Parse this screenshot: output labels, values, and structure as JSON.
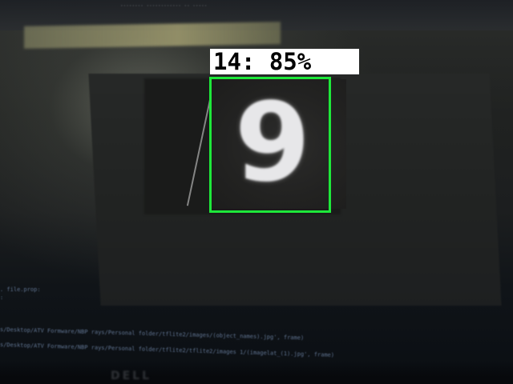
{
  "detection": {
    "class_id": "14",
    "confidence": "85%",
    "label": "14: 85%",
    "box_color": "#1ee83a"
  },
  "scene": {
    "digit_shown": "9",
    "brand": "DELL",
    "terminal_lines": [
      ". file.prop:",
      ":",
      "s/Desktop/ATV Formware/NBP rays/Personal folder/tflite2/images/(object_names).jpg', frame)",
      "s/Desktop/ATV Formware/NBP rays/Personal folder/tflite2/tflite2/images 1/(imagelat_(1).jpg', frame)"
    ]
  }
}
